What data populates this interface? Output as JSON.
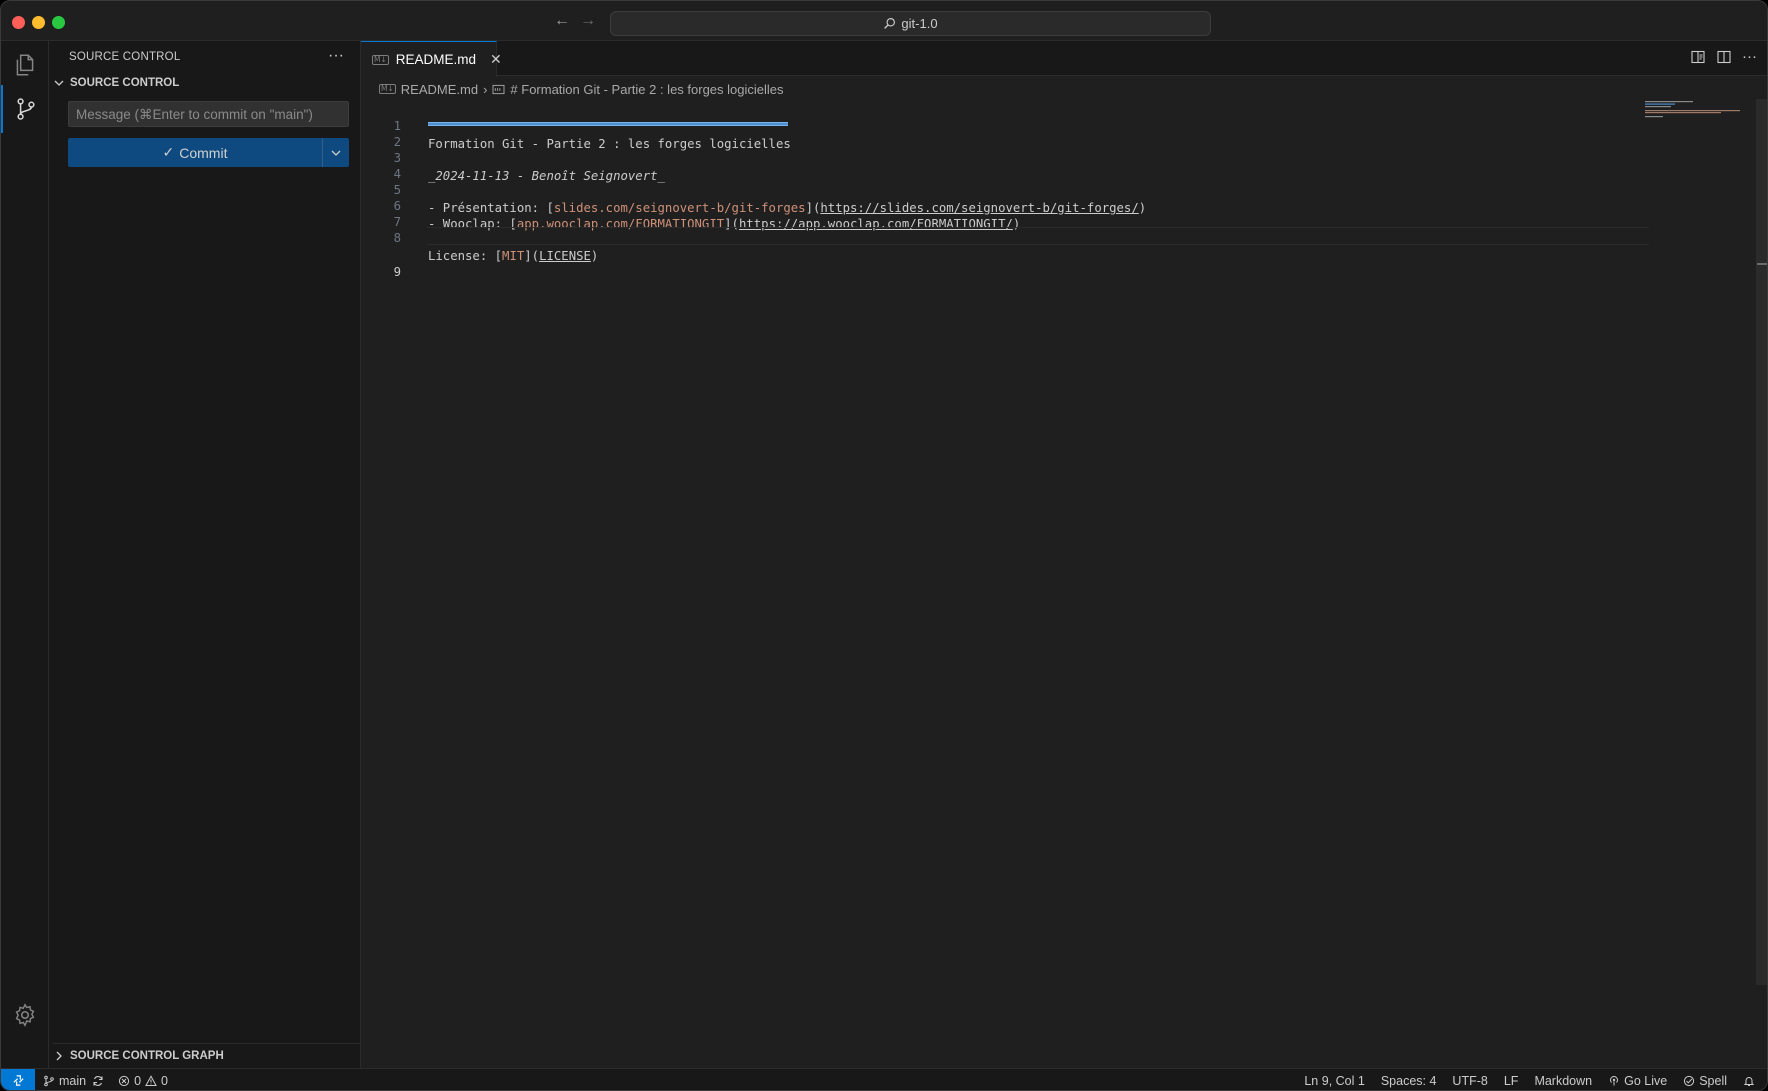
{
  "titlebar": {
    "search_text": "git-1.0",
    "back_icon": "arrow-left-icon",
    "forward_icon": "arrow-right-icon"
  },
  "activitybar": {
    "items": [
      {
        "name": "explorer",
        "icon": "files-icon"
      },
      {
        "name": "source-control",
        "icon": "source-control-icon",
        "active": true
      }
    ],
    "bottom_icon": "gear-icon"
  },
  "sidebar": {
    "header": "SOURCE CONTROL",
    "section_title": "SOURCE CONTROL",
    "commit_message_placeholder": "Message (⌘Enter to commit on \"main\")",
    "commit_label": "Commit",
    "graph_title": "SOURCE CONTROL GRAPH"
  },
  "editor": {
    "tab": {
      "icon_text": "M↓",
      "label": "README.md"
    },
    "breadcrumb": {
      "file": "README.md",
      "symbol": "# Formation Git - Partie 2 : les forges logicielles"
    },
    "lines": [
      {
        "n": "1",
        "text": "Formation Git - Partie 2 : les forges logicielles"
      },
      {
        "n": "2"
      },
      {
        "n": "3",
        "text": "_2024-11-13 - Benoît Seignovert_"
      },
      {
        "n": "4",
        "text": ""
      },
      {
        "n": "5",
        "prefix": "- Présentation: [",
        "link_text": "slides.com/seignovert-b/git-forges",
        "mid": "](",
        "url": "https://slides.com/seignovert-b/git-forges/",
        "suffix": ")"
      },
      {
        "n": "6",
        "prefix": "- Wooclap: [",
        "link_text": "app.wooclap.com/FORMATIONGIT",
        "mid": "](",
        "url": "https://app.wooclap.com/FORMATIONGIT/",
        "suffix": ")"
      },
      {
        "n": "7",
        "text": ""
      },
      {
        "n": "8",
        "prefix": "License: [",
        "link_text": "MIT",
        "mid": "](",
        "url": "LICENSE",
        "suffix": ")"
      },
      {
        "n": "9",
        "text": "",
        "active": true
      }
    ]
  },
  "statusbar": {
    "branch": "main",
    "errors": "0",
    "warnings": "0",
    "position": "Ln 9, Col 1",
    "spaces": "Spaces: 4",
    "encoding": "UTF-8",
    "eol": "LF",
    "language": "Markdown",
    "go_live": "Go Live",
    "spell": "Spell"
  },
  "colors": {
    "accent": "#0078d4",
    "link_text": "#ce9178",
    "commit_button": "#0e4a7f",
    "background": "#1f1f1f"
  }
}
